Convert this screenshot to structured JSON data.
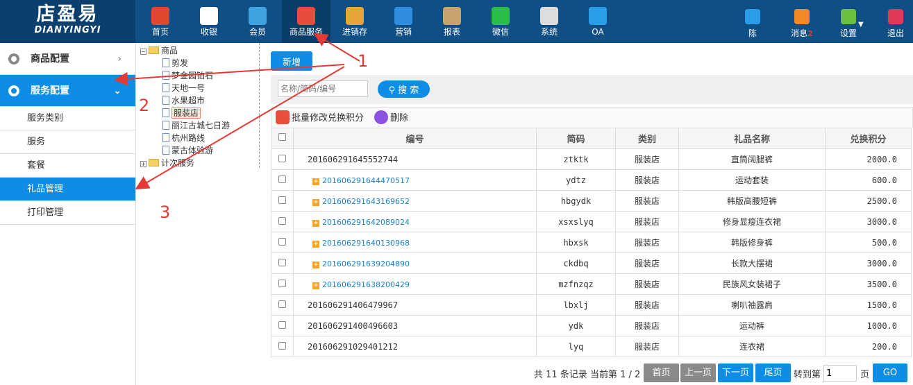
{
  "logo": {
    "cn": "店盈易",
    "en": "DIANYINGYI"
  },
  "nav": [
    {
      "label": "首页",
      "icon": "home-icon",
      "color": "#e04a2a"
    },
    {
      "label": "收银",
      "icon": "cashier-icon",
      "color": "#ffffff"
    },
    {
      "label": "会员",
      "icon": "member-icon",
      "color": "#3fa3e0"
    },
    {
      "label": "商品服务",
      "icon": "goods-service-icon",
      "color": "#e74c3c"
    },
    {
      "label": "进销存",
      "icon": "inventory-icon",
      "color": "#e8a43a"
    },
    {
      "label": "营销",
      "icon": "megaphone-icon",
      "color": "#2f8ee0"
    },
    {
      "label": "报表",
      "icon": "report-icon",
      "color": "#c9a26a"
    },
    {
      "label": "微信",
      "icon": "wechat-icon",
      "color": "#2bbd4a"
    },
    {
      "label": "系统",
      "icon": "monitor-icon",
      "color": "#dddddd"
    },
    {
      "label": "OA",
      "icon": "oa-icon",
      "color": "#2a9de8"
    }
  ],
  "user": {
    "label": "陈",
    "icon": "user-icon",
    "color": "#2a9de8"
  },
  "message": {
    "label": "消息",
    "badge": "2",
    "icon": "bell-icon",
    "color": "#f08a24"
  },
  "settings": {
    "label": "设置",
    "icon": "gear-icon",
    "color": "#6cbf3e"
  },
  "logout": {
    "label": "退出",
    "icon": "logout-icon",
    "color": "#e0395a"
  },
  "sidebar": {
    "groups": [
      {
        "label": "商品配置",
        "chev": "›"
      },
      {
        "label": "服务配置",
        "chev": "⌄"
      }
    ],
    "items": [
      {
        "label": "服务类别"
      },
      {
        "label": "服务"
      },
      {
        "label": "套餐"
      },
      {
        "label": "礼品管理"
      },
      {
        "label": "打印管理"
      }
    ]
  },
  "tree": {
    "root": "商品",
    "children": [
      "剪发",
      "梦金园铂石",
      "天地一号",
      "水果超市",
      "服装店",
      "丽江古城七日游",
      "杭州路线",
      "蒙古体验游"
    ],
    "selected": "服装店",
    "other": "计次服务"
  },
  "toolbar": {
    "add": "新增",
    "search_placeholder": "名称/简码/编号",
    "search": "搜 索",
    "batch": "批量修改兑换积分",
    "delete": "删除"
  },
  "table": {
    "headers": [
      "编号",
      "简码",
      "类别",
      "礼品名称",
      "兑换积分"
    ],
    "rows": [
      {
        "code": "201606291645552744",
        "short": "ztktk",
        "category": "服装店",
        "name": "直筒阔腿裤",
        "points": "2000.0",
        "expandable": false
      },
      {
        "code": "201606291644470517",
        "short": "ydtz",
        "category": "服装店",
        "name": "运动套装",
        "points": "600.0",
        "expandable": true
      },
      {
        "code": "201606291643169652",
        "short": "hbgydk",
        "category": "服装店",
        "name": "韩版高腰短裤",
        "points": "2500.0",
        "expandable": true
      },
      {
        "code": "201606291642089024",
        "short": "xsxslyq",
        "category": "服装店",
        "name": "修身显瘦连衣裙",
        "points": "3000.0",
        "expandable": true
      },
      {
        "code": "201606291640130968",
        "short": "hbxsk",
        "category": "服装店",
        "name": "韩版修身裤",
        "points": "500.0",
        "expandable": true
      },
      {
        "code": "201606291639204890",
        "short": "ckdbq",
        "category": "服装店",
        "name": "长款大摆裙",
        "points": "3000.0",
        "expandable": true
      },
      {
        "code": "201606291638200429",
        "short": "mzfnzqz",
        "category": "服装店",
        "name": "民族风女装裙子",
        "points": "3500.0",
        "expandable": true
      },
      {
        "code": "201606291406479967",
        "short": "lbxlj",
        "category": "服装店",
        "name": "喇叭袖露肩",
        "points": "1500.0",
        "expandable": false
      },
      {
        "code": "201606291400496603",
        "short": "ydk",
        "category": "服装店",
        "name": "运动裤",
        "points": "1000.0",
        "expandable": false
      },
      {
        "code": "201606291029401212",
        "short": "lyq",
        "category": "服装店",
        "name": "连衣裙",
        "points": "200.0",
        "expandable": false
      }
    ]
  },
  "pager": {
    "info": "共 11 条记录 当前第 1 / 2",
    "first": "首页",
    "prev": "上一页",
    "next": "下一页",
    "last": "尾页",
    "goto": "转到第",
    "page_value": "1",
    "page_unit": "页",
    "go": "GO"
  },
  "annotations": [
    "1",
    "2",
    "3"
  ]
}
